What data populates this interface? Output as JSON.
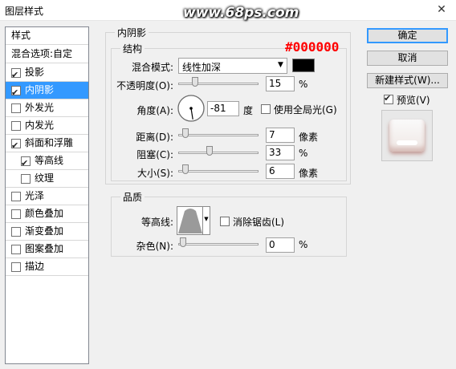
{
  "window": {
    "title": "图层样式",
    "watermark": "www.68ps.com",
    "close_glyph": "✕"
  },
  "left_panel": {
    "header": "样式",
    "blend_options": "混合选项:自定",
    "items": [
      {
        "label": "投影",
        "checked": true,
        "selected": false,
        "indent": false
      },
      {
        "label": "内阴影",
        "checked": true,
        "selected": true,
        "indent": false
      },
      {
        "label": "外发光",
        "checked": false,
        "selected": false,
        "indent": false
      },
      {
        "label": "内发光",
        "checked": false,
        "selected": false,
        "indent": false
      },
      {
        "label": "斜面和浮雕",
        "checked": true,
        "selected": false,
        "indent": false
      },
      {
        "label": "等高线",
        "checked": true,
        "selected": false,
        "indent": true
      },
      {
        "label": "纹理",
        "checked": false,
        "selected": false,
        "indent": true
      },
      {
        "label": "光泽",
        "checked": false,
        "selected": false,
        "indent": false
      },
      {
        "label": "颜色叠加",
        "checked": false,
        "selected": false,
        "indent": false
      },
      {
        "label": "渐变叠加",
        "checked": false,
        "selected": false,
        "indent": false
      },
      {
        "label": "图案叠加",
        "checked": false,
        "selected": false,
        "indent": false
      },
      {
        "label": "描边",
        "checked": false,
        "selected": false,
        "indent": false
      }
    ]
  },
  "inner_shadow": {
    "section_title": "内阴影",
    "structure_title": "结构",
    "color_annotation": "#000000",
    "color_annotation_color": "#ff0000",
    "swatch_color": "#000000",
    "blend_mode_label": "混合模式:",
    "blend_mode_value": "线性加深",
    "opacity_label": "不透明度(O):",
    "opacity_value": "15",
    "opacity_fraction": 0.15,
    "percent": "%",
    "angle_label": "角度(A):",
    "angle_value": "-81",
    "angle_deg": -81,
    "degree_unit": "度",
    "global_light_label": "使用全局光(G)",
    "global_light_checked": false,
    "distance_label": "距离(D):",
    "distance_value": "7",
    "distance_fraction": 0.03,
    "choke_label": "阻塞(C):",
    "choke_value": "33",
    "choke_fraction": 0.33,
    "size_label": "大小(S):",
    "size_value": "6",
    "size_fraction": 0.03,
    "pixel_unit": "像素"
  },
  "quality": {
    "title": "品质",
    "contour_label": "等高线:",
    "antialias_label": "消除锯齿(L)",
    "antialias_checked": false,
    "noise_label": "杂色(N):",
    "noise_value": "0",
    "noise_fraction": 0,
    "percent": "%"
  },
  "right": {
    "ok": "确定",
    "cancel": "取消",
    "new_style": "新建样式(W)...",
    "preview_label": "预览(V)",
    "preview_checked": true
  }
}
